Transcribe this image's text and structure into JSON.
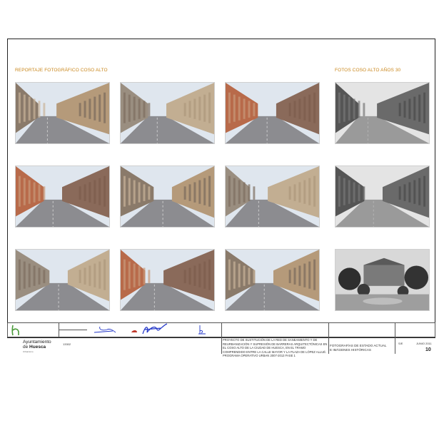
{
  "sections": {
    "left_title": "REPORTAJE FOTOGRÁFICO COSO ALTO",
    "right_title": "FOTOS COSO ALTO AÑOS 30"
  },
  "photos": [
    {
      "name": "photo-coso-alto-1",
      "style": "color"
    },
    {
      "name": "photo-coso-alto-2",
      "style": "color"
    },
    {
      "name": "photo-coso-alto-3",
      "style": "color"
    },
    {
      "name": "photo-historic-1",
      "style": "bw"
    },
    {
      "name": "photo-coso-alto-4",
      "style": "color"
    },
    {
      "name": "photo-coso-alto-5",
      "style": "color"
    },
    {
      "name": "photo-coso-alto-6",
      "style": "color"
    },
    {
      "name": "photo-historic-2",
      "style": "bw"
    },
    {
      "name": "photo-coso-alto-7",
      "style": "color"
    },
    {
      "name": "photo-coso-alto-8",
      "style": "color"
    },
    {
      "name": "photo-coso-alto-9",
      "style": "color"
    },
    {
      "name": "photo-historic-3",
      "style": "bw"
    }
  ],
  "title_block": {
    "logo_line1": "Ayuntamiento",
    "logo_line2_prefix": "de ",
    "logo_line2_bold": "Huesca",
    "logo_sub": "Urbanismo",
    "code": "13302",
    "project_text": "PROYECTO DE SUSTITUCIÓN DE LA RED DE SANEAMIENTO Y DE REURBANIZACIÓN Y SUPRESIÓN DE BARRERAS ARQUITECTÓNICAS EN EL COSO ALTO DE LA CIUDAD DE HUESCA, EN EL TRAMO COMPRENDIDO ENTRE LA CALLE MAYOR Y LA PLAZA DE LÓPEZ ALLUÉ. PROGRAMA OPERATIVO URBAN 2007-2013 FASE 1",
    "plan_line1": "FOTOGRAFÍAS DE ESTADO ACTUAL",
    "plan_line2": "E IMÁGENES HISTÓRICAS",
    "scale": "S/E",
    "date": "JUNIO 2011",
    "sheet_number": "10"
  },
  "colors": {
    "accent_title": "#c9861a",
    "signature_blue": "#2236c8",
    "logo_green": "#4a9a3a"
  }
}
